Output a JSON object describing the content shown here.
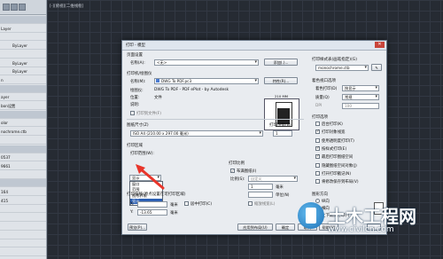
{
  "drawing_tab": "[-][俯视][二维线框]",
  "palette": {
    "rows": [
      {
        "label": "",
        "value": "",
        "section": true
      },
      {
        "label": "Layer",
        "value": ""
      },
      {
        "label": "",
        "value": ""
      },
      {
        "label": "",
        "value": "ByLayer"
      },
      {
        "label": "",
        "value": ""
      },
      {
        "label": "",
        "value": "ByLayer"
      },
      {
        "label": "",
        "value": "ByLayer"
      },
      {
        "label": "n",
        "value": ""
      },
      {
        "label": "",
        "value": "",
        "section": true
      },
      {
        "label": "ayer",
        "value": ""
      },
      {
        "label": "bon设置",
        "value": ""
      },
      {
        "label": "",
        "value": "",
        "section": true
      },
      {
        "label": "olor",
        "value": ""
      },
      {
        "label": "nochrome.ctb",
        "value": ""
      },
      {
        "label": "",
        "value": ""
      },
      {
        "label": "",
        "value": "",
        "section": true
      },
      {
        "label": "0537",
        "value": ""
      },
      {
        "label": "9661",
        "value": ""
      },
      {
        "label": "",
        "value": ""
      },
      {
        "label": "",
        "value": "",
        "section": true
      },
      {
        "label": "164",
        "value": ""
      },
      {
        "label": "415",
        "value": ""
      },
      {
        "label": "",
        "value": ""
      },
      {
        "label": "",
        "value": ""
      },
      {
        "label": "",
        "value": ""
      },
      {
        "label": "",
        "value": ""
      },
      {
        "label": "",
        "value": ""
      },
      {
        "label": "",
        "value": ""
      }
    ]
  },
  "dialog": {
    "title": "打印 - 模型",
    "page_setup": {
      "group": "页面设置",
      "name_label": "名称(A):",
      "name_value": "<无>",
      "add_button": "添加(.)..."
    },
    "printer": {
      "group": "打印机/绘图仪",
      "name_label": "名称(M):",
      "name_value": "DWG To PDF.pc3",
      "props_button": "特性(R)...",
      "plotter_label": "绘图仪:",
      "plotter_value": "DWG To PDF - PDF ePlot - by Autodesk",
      "location_label": "位置:",
      "location_value": "文件",
      "desc_label": "说明:",
      "to_file": "打印到文件(F)",
      "preview_top": "210 MM"
    },
    "paper_size": {
      "group": "图纸尺寸(Z)",
      "value": "ISO A4 (210.00 x 297.00 毫米)"
    },
    "copies": {
      "group": "打印份数(B)",
      "value": "1"
    },
    "plot_area": {
      "group": "打印区域",
      "what_label": "打印范围(W):",
      "what_value": "显示",
      "options": [
        "窗口",
        "范围",
        "图形界限",
        "显示"
      ],
      "selected": "显示"
    },
    "plot_offset": {
      "group": "打印偏移(原点设置在可打印区域)",
      "x_label": "X:",
      "x_value": "",
      "y_label": "Y:",
      "y_value": "-13.65",
      "unit": "毫米",
      "center": "居中打印(C)"
    },
    "plot_scale": {
      "group": "打印比例",
      "fit": "布满图纸(I)",
      "scale_label": "比例(S):",
      "scale_value": "自定义",
      "v1": "1",
      "unit1": "毫米",
      "v2": "",
      "unit2": "单位(N)",
      "lineweights": "缩放线宽(L)"
    },
    "plot_style": {
      "group": "打印样式表(画笔指定)(G)",
      "value": "monochrome.ctb"
    },
    "viewport": {
      "group": "着色视口选项",
      "shade_label": "着色打印(D)",
      "shade_value": "按显示",
      "quality_label": "质量(Q)",
      "quality_value": "常规",
      "dpi_label": "DPI",
      "dpi_value": "100"
    },
    "options": {
      "group": "打印选项",
      "items": [
        {
          "label": "后台打印(K)",
          "checked": false
        },
        {
          "label": "打印对象线宽",
          "checked": true
        },
        {
          "label": "使用透明度打印(T)",
          "checked": false
        },
        {
          "label": "按样式打印(E)",
          "checked": true
        },
        {
          "label": "最后打印图纸空间",
          "checked": true
        },
        {
          "label": "隐藏图纸空间对象(J)",
          "checked": false
        },
        {
          "label": "打开打印戳记(N)",
          "checked": false
        },
        {
          "label": "将修改保存到布局(V)",
          "checked": false
        }
      ]
    },
    "orientation": {
      "group": "图形方向",
      "items": [
        "纵向",
        "横向",
        "上下颠倒打印(-)"
      ]
    },
    "buttons": {
      "preview": "预览(P)...",
      "apply": "应用到布局(U)",
      "ok": "确定",
      "cancel": "取消",
      "help": "帮助(H)"
    }
  },
  "watermark": {
    "brand": "土木工程网",
    "url": "www.civilcn.com"
  }
}
